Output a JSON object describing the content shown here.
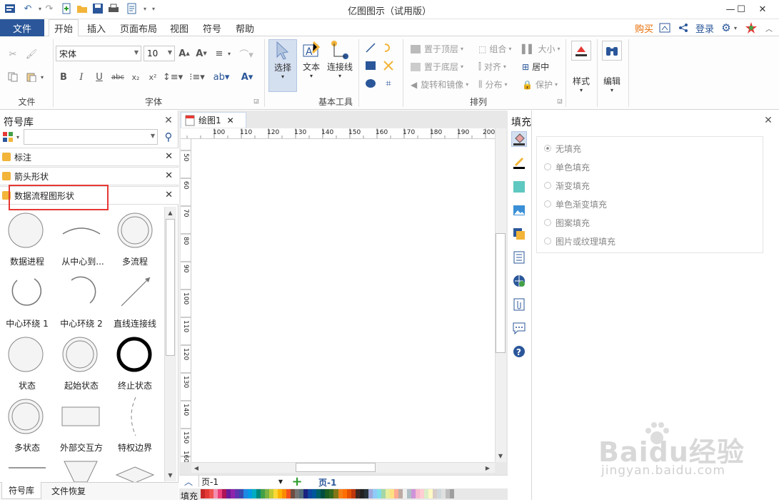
{
  "app": {
    "title": "亿图图示（试用版）",
    "window_controls": [
      "—",
      "☐",
      "✕"
    ]
  },
  "tabs": {
    "file": "文件",
    "items": [
      "开始",
      "插入",
      "页面布局",
      "视图",
      "符号",
      "帮助"
    ],
    "active": "开始",
    "buy": "购买",
    "login": "登录"
  },
  "ribbon": {
    "groups": {
      "file": "文件",
      "font": "字体",
      "basic_tools": "基本工具",
      "arrange": "排列"
    },
    "font_name": "宋体",
    "font_size": "10",
    "tools": {
      "select": "选择",
      "text": "文本",
      "connector": "连接线"
    },
    "arrange_items": {
      "bring_front": "置于顶层",
      "send_back": "置于底层",
      "rotate": "旋转和镜像",
      "group": "组合",
      "align": "对齐",
      "distribute": "分布",
      "size": "大小",
      "center": "居中",
      "protect": "保护"
    },
    "style": "样式",
    "edit": "编辑"
  },
  "library": {
    "title": "符号库",
    "categories": [
      "标注",
      "箭头形状",
      "数据流程图形状"
    ],
    "shapes": [
      "数据进程",
      "从中心到...",
      "多流程",
      "中心环绕 1",
      "中心环绕 2",
      "直线连接线",
      "状态",
      "起始状态",
      "终止状态",
      "多状态",
      "外部交互方",
      "特权边界"
    ],
    "bottom_tabs": [
      "符号库",
      "文件恢复"
    ]
  },
  "document": {
    "tab": "绘图1",
    "ruler_h": [
      "100",
      "110",
      "120",
      "130",
      "140",
      "150",
      "160",
      "170",
      "180",
      "190",
      "200"
    ],
    "ruler_v": [
      "50",
      "60",
      "70",
      "80",
      "90",
      "100",
      "110",
      "120",
      "130",
      "140",
      "150",
      "160"
    ],
    "page_tab": "页-1",
    "page_current": "页-1",
    "fill_label": "填充"
  },
  "fill_panel": {
    "title": "填充",
    "options": [
      "无填充",
      "单色填充",
      "渐变填充",
      "单色渐变填充",
      "图案填充",
      "图片或纹理填充"
    ]
  },
  "watermark": {
    "brand": "Baidu经验",
    "url": "jingyan.baidu.com"
  },
  "colors": {
    "accent": "#2b579a",
    "highlight": "#e53935",
    "buy": "#e86a00"
  }
}
